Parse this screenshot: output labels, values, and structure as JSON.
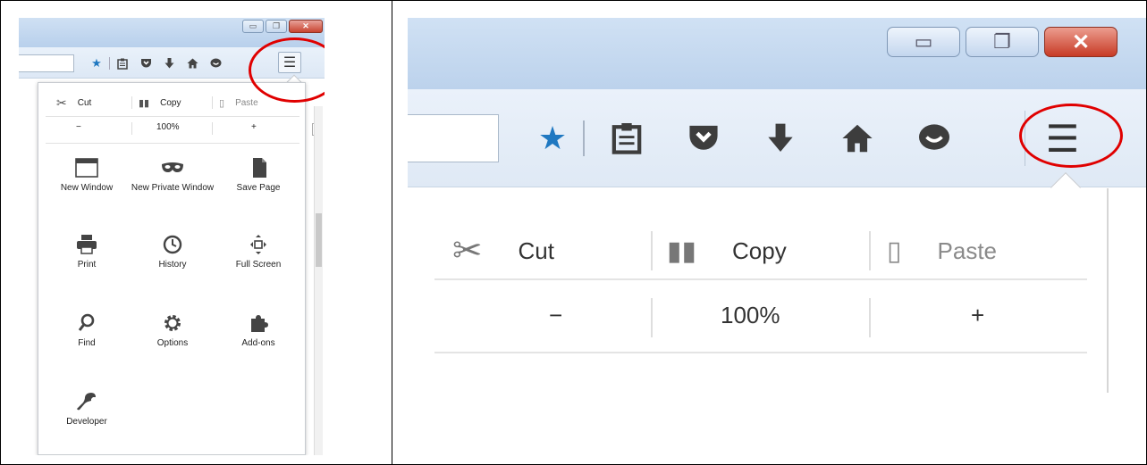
{
  "left": {
    "toolbar_icons": [
      "star-icon",
      "reading-list-icon",
      "pocket-icon",
      "download-icon",
      "home-icon",
      "chat-icon"
    ],
    "menu_button_icon": "hamburger-menu-icon",
    "edit": {
      "cut": "Cut",
      "copy": "Copy",
      "paste": "Paste"
    },
    "zoom": {
      "minus": "−",
      "level": "100%",
      "plus": "+"
    },
    "items": [
      {
        "icon": "window-icon",
        "label": "New Window"
      },
      {
        "icon": "mask-icon",
        "label": "New Private Window"
      },
      {
        "icon": "page-icon",
        "label": "Save Page"
      },
      {
        "icon": "printer-icon",
        "label": "Print"
      },
      {
        "icon": "clock-icon",
        "label": "History"
      },
      {
        "icon": "fullscreen-icon",
        "label": "Full Screen"
      },
      {
        "icon": "magnifier-icon",
        "label": "Find"
      },
      {
        "icon": "gear-icon",
        "label": "Options"
      },
      {
        "icon": "puzzle-icon",
        "label": "Add-ons"
      },
      {
        "icon": "wrench-icon",
        "label": "Developer"
      }
    ]
  },
  "right": {
    "edit": {
      "cut": "Cut",
      "copy": "Copy",
      "paste": "Paste"
    },
    "zoom": {
      "minus": "−",
      "level": "100%",
      "plus": "+"
    }
  },
  "highlight_color": "#e00000",
  "accent_color": "#1f78c1"
}
